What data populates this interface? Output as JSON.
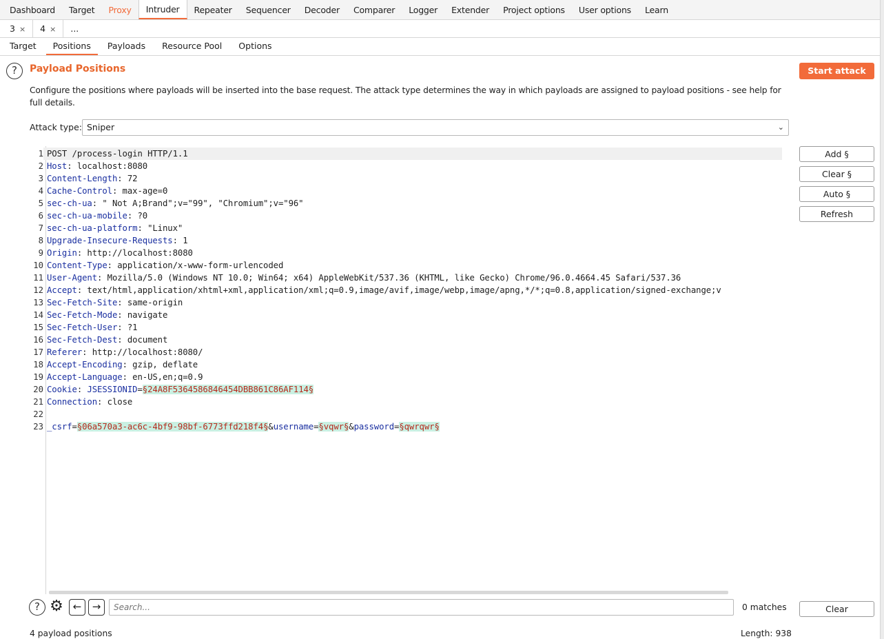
{
  "top_tabs": [
    "Dashboard",
    "Target",
    "Proxy",
    "Intruder",
    "Repeater",
    "Sequencer",
    "Decoder",
    "Comparer",
    "Logger",
    "Extender",
    "Project options",
    "User options",
    "Learn"
  ],
  "num_tabs": [
    {
      "label": "3",
      "close": "×"
    },
    {
      "label": "4",
      "close": "×"
    },
    {
      "label": "...",
      "close": ""
    }
  ],
  "sub_tabs": [
    "Target",
    "Positions",
    "Payloads",
    "Resource Pool",
    "Options"
  ],
  "header": {
    "title": "Payload Positions",
    "description": "Configure the positions where payloads will be inserted into the base request. The attack type determines the way in which payloads are assigned to payload positions - see help for full details.",
    "start_attack": "Start attack",
    "help_icon": "question-circle-icon"
  },
  "attack_type": {
    "label": "Attack type:",
    "value": "Sniper"
  },
  "request_lines": [
    {
      "n": "1",
      "parts": [
        {
          "t": "POST /process-login HTTP/1.1"
        }
      ]
    },
    {
      "n": "2",
      "parts": [
        {
          "t": "Host",
          "c": "hn"
        },
        {
          "t": ": localhost:8080"
        }
      ]
    },
    {
      "n": "3",
      "parts": [
        {
          "t": "Content-Length",
          "c": "hn"
        },
        {
          "t": ": 72"
        }
      ]
    },
    {
      "n": "4",
      "parts": [
        {
          "t": "Cache-Control",
          "c": "hn"
        },
        {
          "t": ": max-age=0"
        }
      ]
    },
    {
      "n": "5",
      "parts": [
        {
          "t": "sec-ch-ua",
          "c": "hn"
        },
        {
          "t": ": \" Not A;Brand\";v=\"99\", \"Chromium\";v=\"96\""
        }
      ]
    },
    {
      "n": "6",
      "parts": [
        {
          "t": "sec-ch-ua-mobile",
          "c": "hn"
        },
        {
          "t": ": ?0"
        }
      ]
    },
    {
      "n": "7",
      "parts": [
        {
          "t": "sec-ch-ua-platform",
          "c": "hn"
        },
        {
          "t": ": \"Linux\""
        }
      ]
    },
    {
      "n": "8",
      "parts": [
        {
          "t": "Upgrade-Insecure-Requests",
          "c": "hn"
        },
        {
          "t": ": 1"
        }
      ]
    },
    {
      "n": "9",
      "parts": [
        {
          "t": "Origin",
          "c": "hn"
        },
        {
          "t": ": http://localhost:8080"
        }
      ]
    },
    {
      "n": "10",
      "parts": [
        {
          "t": "Content-Type",
          "c": "hn"
        },
        {
          "t": ": application/x-www-form-urlencoded"
        }
      ]
    },
    {
      "n": "11",
      "parts": [
        {
          "t": "User-Agent",
          "c": "hn"
        },
        {
          "t": ": Mozilla/5.0 (Windows NT 10.0; Win64; x64) AppleWebKit/537.36 (KHTML, like Gecko) Chrome/96.0.4664.45 Safari/537.36"
        }
      ]
    },
    {
      "n": "12",
      "parts": [
        {
          "t": "Accept",
          "c": "hn"
        },
        {
          "t": ": text/html,application/xhtml+xml,application/xml;q=0.9,image/avif,image/webp,image/apng,*/*;q=0.8,application/signed-exchange;v"
        }
      ]
    },
    {
      "n": "13",
      "parts": [
        {
          "t": "Sec-Fetch-Site",
          "c": "hn"
        },
        {
          "t": ": same-origin"
        }
      ]
    },
    {
      "n": "14",
      "parts": [
        {
          "t": "Sec-Fetch-Mode",
          "c": "hn"
        },
        {
          "t": ": navigate"
        }
      ]
    },
    {
      "n": "15",
      "parts": [
        {
          "t": "Sec-Fetch-User",
          "c": "hn"
        },
        {
          "t": ": ?1"
        }
      ]
    },
    {
      "n": "16",
      "parts": [
        {
          "t": "Sec-Fetch-Dest",
          "c": "hn"
        },
        {
          "t": ": document"
        }
      ]
    },
    {
      "n": "17",
      "parts": [
        {
          "t": "Referer",
          "c": "hn"
        },
        {
          "t": ": http://localhost:8080/"
        }
      ]
    },
    {
      "n": "18",
      "parts": [
        {
          "t": "Accept-Encoding",
          "c": "hn"
        },
        {
          "t": ": gzip, deflate"
        }
      ]
    },
    {
      "n": "19",
      "parts": [
        {
          "t": "Accept-Language",
          "c": "hn"
        },
        {
          "t": ": en-US,en;q=0.9"
        }
      ]
    },
    {
      "n": "20",
      "parts": [
        {
          "t": "Cookie",
          "c": "hn"
        },
        {
          "t": ": "
        },
        {
          "t": "JSESSIONID",
          "c": "pn"
        },
        {
          "t": "="
        },
        {
          "t": "§24A8F5364586846454DBB861C86AF114§",
          "c": "mark"
        }
      ]
    },
    {
      "n": "21",
      "parts": [
        {
          "t": "Connection",
          "c": "hn"
        },
        {
          "t": ": close"
        }
      ]
    },
    {
      "n": "22",
      "parts": [
        {
          "t": ""
        }
      ]
    },
    {
      "n": "23",
      "parts": [
        {
          "t": "_csrf",
          "c": "pn"
        },
        {
          "t": "="
        },
        {
          "t": "§06a570a3-ac6c-4bf9-98bf-6773ffd218f4§",
          "c": "mark"
        },
        {
          "t": "&"
        },
        {
          "t": "username",
          "c": "pn"
        },
        {
          "t": "="
        },
        {
          "t": "§vqwr§",
          "c": "mark"
        },
        {
          "t": "&"
        },
        {
          "t": "password",
          "c": "pn"
        },
        {
          "t": "="
        },
        {
          "t": "§qwrqwr§",
          "c": "mark"
        }
      ]
    }
  ],
  "side_buttons": {
    "add": "Add §",
    "clear": "Clear §",
    "auto": "Auto §",
    "refresh": "Refresh",
    "clear_search": "Clear"
  },
  "search": {
    "placeholder": "Search...",
    "matches": "0 matches"
  },
  "footer": {
    "positions": "4 payload positions",
    "length": "Length: 938"
  },
  "icons": {
    "help": "question-circle-icon",
    "settings": "gear-icon",
    "back": "arrow-left-icon",
    "forward": "arrow-right-icon",
    "dropdown": "chevron-down-icon"
  },
  "colors": {
    "accent": "#f26b3a",
    "title": "#e8662c",
    "header_name": "#1a2fa0",
    "marker_bg": "#c9f0e2",
    "marker_text": "#b52a1c"
  }
}
